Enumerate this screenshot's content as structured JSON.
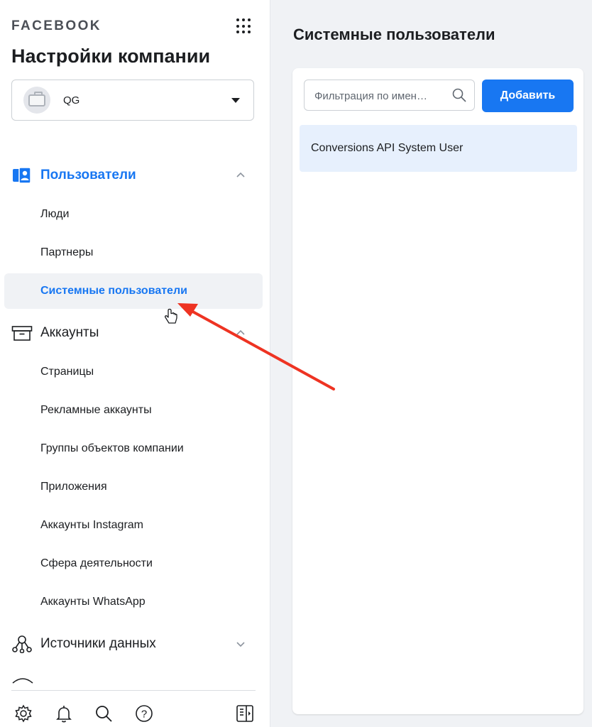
{
  "sidebar": {
    "brand": "FACEBOOK",
    "title": "Настройки компании",
    "account": {
      "name": "QG"
    },
    "sections": {
      "users": {
        "label": "Пользователи",
        "items": [
          "Люди",
          "Партнеры",
          "Системные пользователи"
        ],
        "active_item": "Системные пользователи"
      },
      "accounts": {
        "label": "Аккаунты",
        "items": [
          "Страницы",
          "Рекламные аккаунты",
          "Группы объектов компании",
          "Приложения",
          "Аккаунты Instagram",
          "Сфера деятельности",
          "Аккаунты WhatsApp"
        ]
      },
      "data_sources": {
        "label": "Источники данных"
      }
    },
    "bottom_icons": [
      "gear-icon",
      "bell-icon",
      "search-icon",
      "help-icon",
      "panel-toggle-icon"
    ]
  },
  "main": {
    "title": "Системные пользователи",
    "filter": {
      "placeholder": "Фильтрация по имен…",
      "value": ""
    },
    "add_button_label": "Добавить",
    "users": [
      "Conversions API System User"
    ]
  },
  "colors": {
    "accent": "#1877f2",
    "active_bg": "#f0f2f5",
    "selected_row_bg": "#e7f0fd",
    "annotation_arrow": "#ee3322"
  }
}
